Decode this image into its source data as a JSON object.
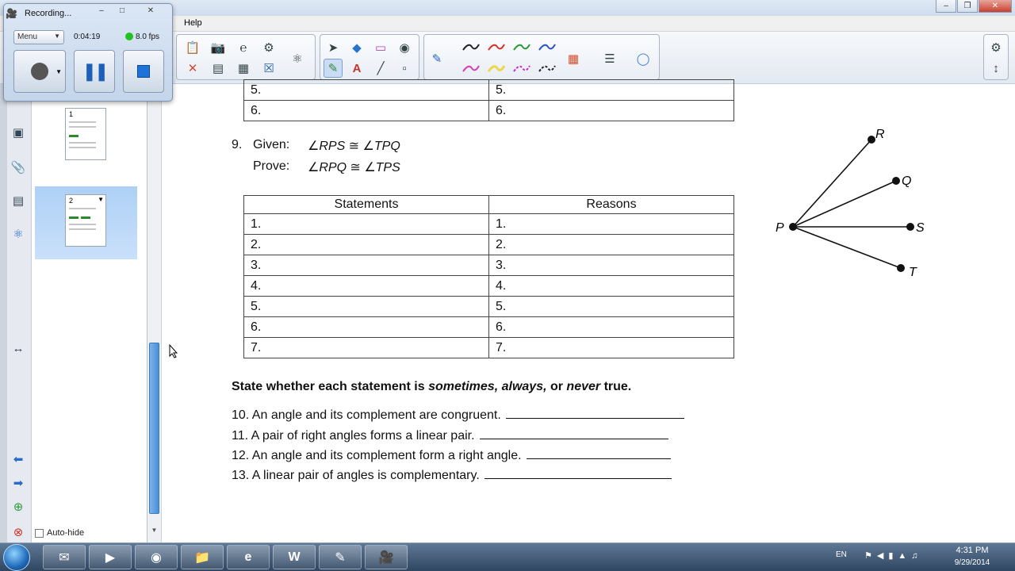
{
  "menubar": {
    "help": "Help"
  },
  "recorder": {
    "title": "Recording...",
    "menu_label": "Menu",
    "elapsed": "0:04:19",
    "fps": "8.0 fps"
  },
  "sidebar": {
    "pages": [
      {
        "number": "1"
      },
      {
        "number": "2"
      }
    ],
    "autohide_label": "Auto-hide"
  },
  "top_table": {
    "rows": [
      {
        "statement": "5.",
        "reason": "5."
      },
      {
        "statement": "6.",
        "reason": "6."
      }
    ]
  },
  "problem9": {
    "number": "9.",
    "given_label": "Given:",
    "given_expr": "∠RPS ≅ ∠TPQ",
    "prove_label": "Prove:",
    "prove_expr": "∠RPQ ≅ ∠TPS",
    "headers": {
      "statements": "Statements",
      "reasons": "Reasons"
    },
    "rows": [
      {
        "statement": "1.",
        "reason": "1."
      },
      {
        "statement": "2.",
        "reason": "2."
      },
      {
        "statement": "3.",
        "reason": "3."
      },
      {
        "statement": "4.",
        "reason": "4."
      },
      {
        "statement": "5.",
        "reason": "5."
      },
      {
        "statement": "6.",
        "reason": "6."
      },
      {
        "statement": "7.",
        "reason": "7."
      }
    ],
    "diagram": {
      "vertex": "P",
      "rays": [
        "R",
        "Q",
        "S",
        "T"
      ]
    }
  },
  "instruction": {
    "lead": "State whether each statement is ",
    "w1": "sometimes,",
    "w2": "always,",
    "mid": " or ",
    "w3": "never",
    "tail": " true."
  },
  "questions": [
    {
      "text": "10.  An angle and its complement are congruent."
    },
    {
      "text": "11.  A pair of right angles forms a linear pair."
    },
    {
      "text": "12.  An angle and its complement form a right angle."
    },
    {
      "text": "13.  A linear pair of angles is complementary."
    }
  ],
  "taskbar": {
    "apps": [
      "outlook-app",
      "camtasia-app",
      "chrome-app",
      "explorer-app",
      "ie-app",
      "word-app",
      "notebook-app",
      "recorder-app"
    ],
    "word_label": "W",
    "lang": "EN",
    "time": "4:31 PM",
    "date": "9/29/2014"
  },
  "colors": {
    "accent": "#3a79c0",
    "record_green": "#23c223",
    "stop_blue": "#1e72d8"
  }
}
